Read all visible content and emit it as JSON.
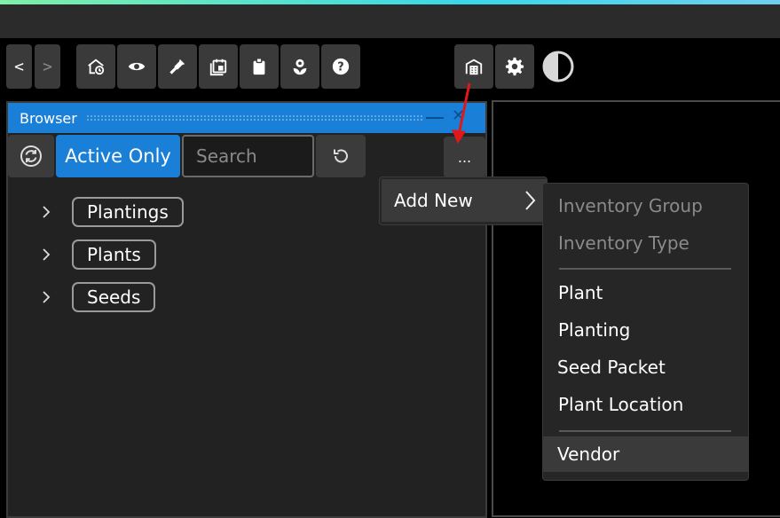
{
  "toolbar": {
    "nav": [
      {
        "label": "<",
        "enabled": true
      },
      {
        "label": ">",
        "enabled": false
      }
    ],
    "tools": [
      {
        "icon": "home-clock-icon"
      },
      {
        "icon": "eye-icon"
      },
      {
        "icon": "shovel-icon"
      },
      {
        "icon": "calendar-icon"
      },
      {
        "icon": "clipboard-icon"
      },
      {
        "icon": "flower-icon"
      },
      {
        "icon": "help-icon"
      }
    ],
    "right_tools": [
      {
        "icon": "warehouse-icon"
      },
      {
        "icon": "gear-icon"
      }
    ],
    "theme_icon": "contrast-icon"
  },
  "browser": {
    "title": "Browser",
    "active_only_label": "Active Only",
    "search": {
      "placeholder": "Search",
      "value": ""
    },
    "more_label": "...",
    "tree": [
      {
        "label": "Plantings"
      },
      {
        "label": "Plants"
      },
      {
        "label": "Seeds"
      }
    ]
  },
  "context_menu": {
    "add_new_label": "Add New",
    "submenu": {
      "inventory_group": "Inventory Group",
      "inventory_type": "Inventory Type",
      "plant": "Plant",
      "planting": "Planting",
      "seed_packet": "Seed Packet",
      "plant_location": "Plant Location",
      "vendor": "Vendor"
    }
  },
  "colors": {
    "accent": "#1a7fd6",
    "background": "#000000",
    "panel": "#222222",
    "annotation_arrow": "#e01818"
  }
}
